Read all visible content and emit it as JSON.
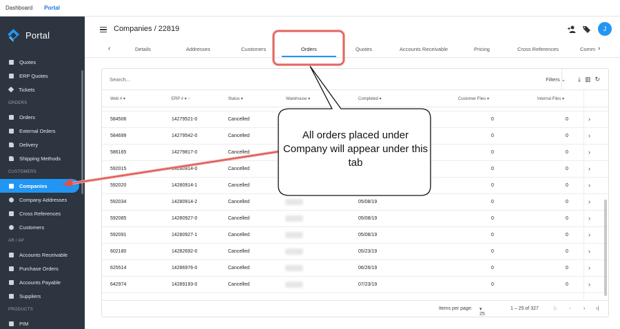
{
  "topbar": {
    "links": [
      "Dashboard",
      "Portal"
    ],
    "active": "Portal"
  },
  "brand": {
    "name": "Portal",
    "colors": {
      "sidebar": "#2c3540",
      "accent": "#2196f3"
    }
  },
  "sidebar": {
    "items": [
      {
        "type": "item",
        "label": "Quotes",
        "icon": "document-icon"
      },
      {
        "type": "item",
        "label": "ERP Quotes",
        "icon": "document-icon"
      },
      {
        "type": "item",
        "label": "Tickets",
        "icon": "tag-icon"
      },
      {
        "type": "section",
        "label": "ORDERS"
      },
      {
        "type": "item",
        "label": "Orders",
        "icon": "document-icon"
      },
      {
        "type": "item",
        "label": "External Orders",
        "icon": "external-arrow-icon"
      },
      {
        "type": "item",
        "label": "Delivery",
        "icon": "truck-icon"
      },
      {
        "type": "item",
        "label": "Shipping Methods",
        "icon": "truck-icon"
      },
      {
        "type": "section",
        "label": "CUSTOMERS"
      },
      {
        "type": "item",
        "label": "Companies",
        "icon": "building-icon",
        "active": true
      },
      {
        "type": "item",
        "label": "Company Addresses",
        "icon": "location-pin-icon"
      },
      {
        "type": "item",
        "label": "Cross References",
        "icon": "swap-icon"
      },
      {
        "type": "item",
        "label": "Customers",
        "icon": "people-icon"
      },
      {
        "type": "section",
        "label": "AR / AP"
      },
      {
        "type": "item",
        "label": "Accounts Receivable",
        "icon": "ledger-icon"
      },
      {
        "type": "item",
        "label": "Purchase Orders",
        "icon": "ledger-icon"
      },
      {
        "type": "item",
        "label": "Accounts Payable",
        "icon": "calculator-icon"
      },
      {
        "type": "item",
        "label": "Suppliers",
        "icon": "box-icon"
      },
      {
        "type": "section",
        "label": "PRODUCTS"
      },
      {
        "type": "item",
        "label": "PIM",
        "icon": "document-icon"
      }
    ]
  },
  "header": {
    "title": "Companies / 22819",
    "avatar_initial": "J"
  },
  "tabs": {
    "items": [
      "Details",
      "Addresses",
      "Customers",
      "Orders",
      "Quotes",
      "Accounts Receivable",
      "Pricing",
      "Cross References",
      "Comm"
    ],
    "active": "Orders"
  },
  "table": {
    "search_placeholder": "Search...",
    "filters_label": "Filters",
    "columns": [
      "Web #",
      "ERP #",
      "Status",
      "Warehouse",
      "Completed",
      "Customer Files",
      "Internal Files"
    ],
    "rows": [
      {
        "web": "584506",
        "erp": "14279521-0",
        "status": "Cancelled",
        "completed": "",
        "customer_files": "0",
        "internal_files": "0"
      },
      {
        "web": "584699",
        "erp": "14279542-0",
        "status": "Cancelled",
        "completed": "",
        "customer_files": "0",
        "internal_files": "0"
      },
      {
        "web": "586165",
        "erp": "14279817-0",
        "status": "Cancelled",
        "completed": "",
        "customer_files": "0",
        "internal_files": "0"
      },
      {
        "web": "592015",
        "erp": "14280914-0",
        "status": "Cancelled",
        "completed": "",
        "customer_files": "0",
        "internal_files": "0"
      },
      {
        "web": "592020",
        "erp": "14280914-1",
        "status": "Cancelled",
        "completed": "",
        "customer_files": "0",
        "internal_files": "0"
      },
      {
        "web": "592034",
        "erp": "14280914-2",
        "status": "Cancelled",
        "completed": "05/08/19",
        "customer_files": "0",
        "internal_files": "0"
      },
      {
        "web": "592085",
        "erp": "14280927-0",
        "status": "Cancelled",
        "completed": "05/08/19",
        "customer_files": "0",
        "internal_files": "0"
      },
      {
        "web": "592091",
        "erp": "14280927-1",
        "status": "Cancelled",
        "completed": "05/08/19",
        "customer_files": "0",
        "internal_files": "0"
      },
      {
        "web": "602180",
        "erp": "14282692-0",
        "status": "Cancelled",
        "completed": "05/23/19",
        "customer_files": "0",
        "internal_files": "0"
      },
      {
        "web": "625514",
        "erp": "14286976-0",
        "status": "Cancelled",
        "completed": "06/26/19",
        "customer_files": "0",
        "internal_files": "0"
      },
      {
        "web": "642974",
        "erp": "14289193-0",
        "status": "Cancelled",
        "completed": "07/23/19",
        "customer_files": "0",
        "internal_files": "0"
      }
    ]
  },
  "pager": {
    "items_per_page_label": "Items per page:",
    "page_size": "25",
    "range": "1 – 25 of 327"
  },
  "callout": {
    "text": "All orders placed under Company will appear under this tab"
  }
}
